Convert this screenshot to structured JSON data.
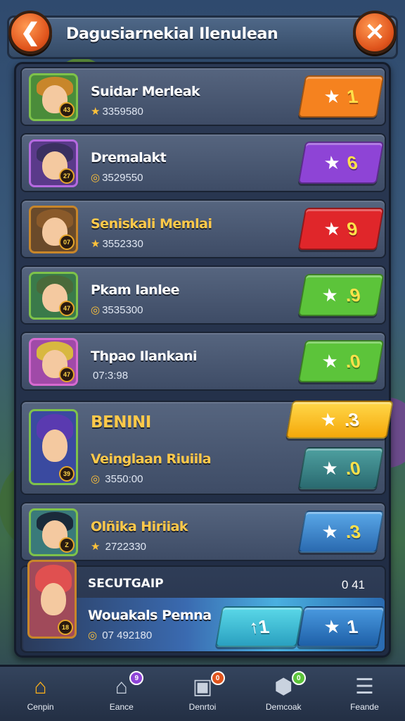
{
  "header": {
    "title": "Dagusiarnekial Ilenulean",
    "back_icon": "back-arrow-icon",
    "close_icon": "close-icon",
    "back_glyph": "❮",
    "close_glyph": "✕"
  },
  "leaderboard": {
    "rows": [
      {
        "name": "Suidar Merleak",
        "score": "3359580",
        "badge_value": "1",
        "badge_color": "#f5821f",
        "avatar_border": "#7ec24a",
        "avatar_bg": "#4a8c3a",
        "hair": "#c8862a",
        "level": "43",
        "score_glyph": "★"
      },
      {
        "name": "Dremalakt",
        "score": "3529550",
        "badge_value": "6",
        "badge_color": "#8e44d6",
        "avatar_border": "#b56ae0",
        "avatar_bg": "#5a3a8a",
        "hair": "#3a3060",
        "level": "27",
        "score_glyph": "◎"
      },
      {
        "name": "Seniskali Memlai",
        "score": "3552330",
        "badge_value": "9",
        "badge_color": "#e0262a",
        "avatar_border": "#c8862a",
        "avatar_bg": "#6a4a2a",
        "hair": "#8a5a2a",
        "level": "07",
        "score_glyph": "★"
      },
      {
        "name": "Pkam Ianlee",
        "score": "3535300",
        "badge_value": ".9",
        "badge_color": "#5cc43a",
        "avatar_border": "#7ec24a",
        "avatar_bg": "#3a7a4a",
        "hair": "#4a6a3a",
        "level": "47",
        "score_glyph": "◎"
      },
      {
        "name": "Thpao Ilankani",
        "score": "07:3:98",
        "badge_value": ".0",
        "badge_color": "#5cc43a",
        "avatar_border": "#d66ad0",
        "avatar_bg": "#a04aa8",
        "hair": "#d8b840",
        "level": "47",
        "score_glyph": ""
      }
    ],
    "featured": {
      "tag": "BENINI",
      "name": "Veinglaan Riuiila",
      "score": "3550:00",
      "score_glyph": "◎",
      "badge_top": ".3",
      "badge_top_color": "#ffc21a",
      "badge_bottom": ".0",
      "badge_bottom_color": "#3a8a8a",
      "level": "39"
    },
    "row7": {
      "name": "Olñika Hiriiak",
      "score": "2722330",
      "badge_value": ".3",
      "badge_color": "#3a8ad6",
      "level": "Z",
      "score_glyph": "★"
    },
    "current_player": {
      "section_label": "SECUTGAIP",
      "section_value": "0 41",
      "name": "Wouakals Pemna",
      "score": "07 492180",
      "score_glyph": "◎",
      "badge_left": "↑1",
      "badge_left_color": "#3ac6d6",
      "badge_right": "1",
      "badge_right_color": "#2a8ad0",
      "level": "18"
    },
    "badge_star": "★"
  },
  "nav": {
    "items": [
      {
        "label": "Cenpin",
        "icon": "home-icon",
        "glyph": "⌂",
        "color": "#ffb21a",
        "dot": "",
        "dot_color": ""
      },
      {
        "label": "Eance",
        "icon": "house-icon",
        "glyph": "⌂",
        "color": "#c9d2df",
        "dot": "9",
        "dot_color": "#8e44d6"
      },
      {
        "label": "Denrtoi",
        "icon": "chest-icon",
        "glyph": "▣",
        "color": "#c9d2df",
        "dot": "0",
        "dot_color": "#e0541c"
      },
      {
        "label": "Demcoak",
        "icon": "box-icon",
        "glyph": "⬢",
        "color": "#c9d2df",
        "dot": "0",
        "dot_color": "#5cc43a"
      },
      {
        "label": "Feande",
        "icon": "menu-icon",
        "glyph": "☰",
        "color": "#c9d2df",
        "dot": "",
        "dot_color": ""
      }
    ]
  }
}
